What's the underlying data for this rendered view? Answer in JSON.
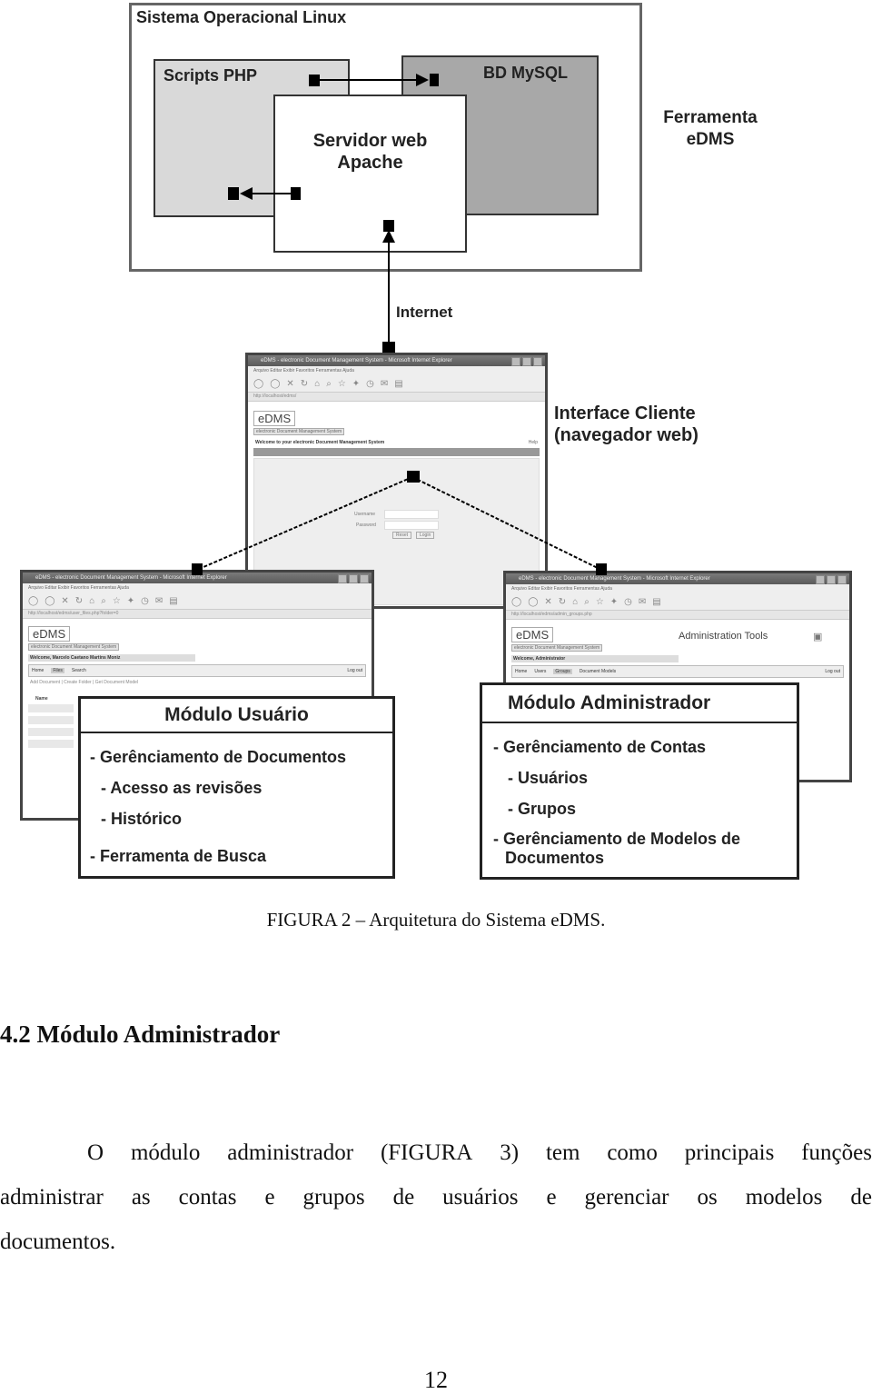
{
  "diagram": {
    "os_label": "Sistema Operacional Linux",
    "scripts_label": "Scripts PHP",
    "db_label": "BD MySQL",
    "server_label_line1": "Servidor web",
    "server_label_line2": "Apache",
    "tool_label_line1": "Ferramenta",
    "tool_label_line2": "eDMS",
    "internet_label": "Internet",
    "client_label_line1": "Interface Cliente",
    "client_label_line2": "(navegador web)",
    "colors": {
      "scripts_fill": "#d9d9d9",
      "db_fill": "#a8a8a8"
    },
    "browser_login": {
      "title": "eDMS - electronic Document Management System - Microsoft Internet Explorer",
      "menu": "Arquivo  Editar  Exibir  Favoritos  Ferramentas  Ajuda",
      "address": "http://localhost/edms/",
      "logo": "eDMS",
      "logo_sub": "electronic Document Management System",
      "welcome": "Welcome to your electronic Document Management System",
      "help": "Help",
      "username_label": "Username",
      "password_label": "Password",
      "reset_button": "Reset",
      "login_button": "Login"
    },
    "browser_user": {
      "title": "eDMS - electronic Document Management System - Microsoft Internet Explorer",
      "menu": "Arquivo  Editar  Exibir  Favoritos  Ferramentas  Ajuda",
      "address": "http://localhost/edms/user_files.php?folder=0",
      "logo": "eDMS",
      "logo_sub": "electronic Document Management System",
      "welcome": "Welcome, Marcelo Caetano Martins Moniz",
      "nav": [
        "Home",
        "Files",
        "Search"
      ],
      "logout": "Log out",
      "actions": "Add Document | Create Folder | Get Document Model",
      "list_header": "Name"
    },
    "browser_admin": {
      "title": "eDMS - electronic Document Management System - Microsoft Internet Explorer",
      "menu": "Arquivo  Editar  Exibir  Favoritos  Ferramentas  Ajuda",
      "address": "http://localhost/edms/admin_groups.php",
      "logo": "eDMS",
      "logo_sub": "electronic Document Management System",
      "tools_title": "Administration Tools",
      "welcome": "Welcome, Administrator",
      "nav": [
        "Home",
        "Users",
        "Groups",
        "Document Models"
      ],
      "logout": "Log out"
    },
    "user_module": {
      "title": "Módulo Usuário",
      "items": [
        "- Gerênciamento de Documentos",
        "- Acesso as revisões",
        "- Histórico",
        "- Ferramenta de Busca"
      ]
    },
    "admin_module": {
      "title": "Módulo Administrador",
      "items": [
        "- Gerênciamento de Contas",
        "- Usuários",
        "- Grupos",
        "- Gerênciamento de Modelos de",
        "Documentos"
      ]
    }
  },
  "caption": "FIGURA 2 – Arquitetura do Sistema eDMS.",
  "section_heading": "4.2 Módulo Administrador",
  "paragraph": {
    "line1": [
      "O",
      "módulo",
      "administrador",
      "(FIGURA",
      "3)",
      "tem",
      "como",
      "principais",
      "funções"
    ],
    "line2": [
      "administrar",
      "as",
      "contas",
      "e",
      "grupos",
      "de",
      "usuários",
      "e",
      "gerenciar",
      "os",
      "modelos",
      "de"
    ],
    "line3": "documentos."
  },
  "page_number": "12"
}
